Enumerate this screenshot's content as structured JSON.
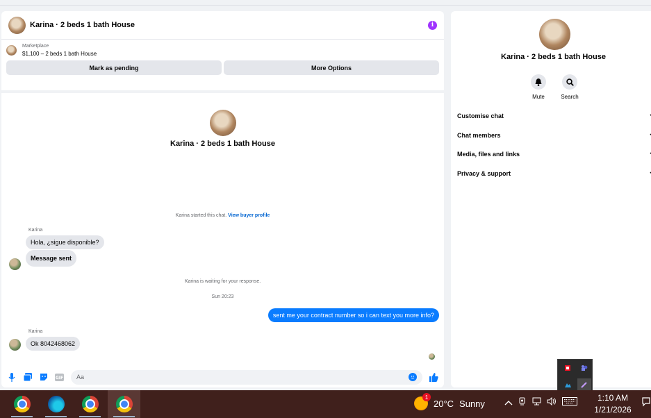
{
  "conversation": {
    "title": "Karina · 2 beds 1 bath House",
    "listing_kind": "Marketplace",
    "listing_price_title": "$1,100 – 2 beds 1 bath House",
    "mark_pending_label": "Mark as pending",
    "more_options_label": "More Options",
    "profile_name": "Karina · 2 beds 1 bath House",
    "started_text": "Karina started this chat.",
    "view_profile_link": "View buyer profile",
    "waiting_text": "Karina is waiting for your response.",
    "timestamp": "Sun 20:23",
    "messages": [
      {
        "sender": "Karina",
        "text": "Hola, ¿sigue disponible?"
      },
      {
        "sender": "",
        "text": "Message sent"
      },
      {
        "sender": "me",
        "text": "sent me your contract number so i can text you more info?"
      },
      {
        "sender": "Karina",
        "text": "Ok 8042468062"
      }
    ],
    "input_placeholder": "Aa"
  },
  "side_panel": {
    "name": "Karina · 2 beds 1 bath House",
    "mute_label": "Mute",
    "search_label": "Search",
    "sections": [
      "Customise chat",
      "Chat members",
      "Media, files and links",
      "Privacy & support"
    ]
  },
  "taskbar": {
    "weather_temp": "20°C",
    "weather_condition": "Sunny",
    "weather_badge": "1",
    "time": "1:10 AM",
    "date": "1/21/2026",
    "apps": [
      "chrome-icon",
      "edge-icon",
      "chrome-icon",
      "chrome-icon"
    ]
  },
  "colors": {
    "accent": "#0a7cff",
    "info": "#a033ff",
    "taskbar": "#40201c"
  }
}
